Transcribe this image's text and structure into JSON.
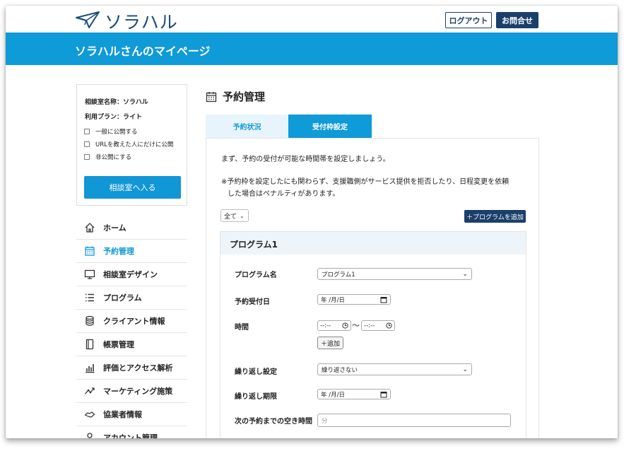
{
  "header": {
    "logo_text": "ソラハル",
    "logout_label": "ログアウト",
    "contact_label": "お問合せ"
  },
  "banner": {
    "title": "ソラハルさんのマイページ"
  },
  "sidebar": {
    "room_name": "相談室名称：ソラハル",
    "plan": "利用プラン：ライト",
    "visibility_options": [
      "一般に公開する",
      "URLを教えた人にだけに公開",
      "非公開にする"
    ],
    "enter_button": "相談室へ入る",
    "nav": [
      {
        "label": "ホーム",
        "icon": "home-icon"
      },
      {
        "label": "予約管理",
        "icon": "calendar-icon",
        "active": true
      },
      {
        "label": "相談室デザイン",
        "icon": "monitor-icon"
      },
      {
        "label": "プログラム",
        "icon": "list-icon"
      },
      {
        "label": "クライアント情報",
        "icon": "database-icon"
      },
      {
        "label": "帳票管理",
        "icon": "document-icon"
      },
      {
        "label": "評価とアクセス解析",
        "icon": "bar-chart-icon"
      },
      {
        "label": "マーケティング施策",
        "icon": "trend-icon"
      },
      {
        "label": "協業者情報",
        "icon": "handshake-icon"
      },
      {
        "label": "アカウント管理",
        "icon": "user-icon"
      }
    ]
  },
  "main": {
    "title": "予約管理",
    "tabs": [
      "予約状況",
      "受付枠設定"
    ],
    "active_tab": "受付枠設定",
    "intro": "まず、予約の受付が可能な時間帯を設定しましょう。",
    "note_line1": "※予約枠を設定したにも関わらず、支援職側がサービス提供を拒否したり、日程変更を依頼",
    "note_line2": "した場合はペナルティがあります。",
    "filter_value": "全て",
    "add_program_button": "＋プログラムを追加",
    "program": {
      "title": "プログラム1",
      "fields": {
        "name_label": "プログラム名",
        "name_value": "プログラム1",
        "date_label": "予約受付日",
        "date_placeholder": "年 /月/日",
        "time_label": "時間",
        "time_placeholder": "--:--",
        "tilde": "〜",
        "add_time_button": "＋追加",
        "repeat_label": "繰り返し設定",
        "repeat_value": "繰り返さない",
        "repeat_until_label": "繰り返し期限",
        "repeat_until_placeholder": "年 /月/日",
        "gap_label": "次の予約までの空き時間",
        "gap_placeholder": "分"
      }
    }
  },
  "colors": {
    "accent": "#0f9ad8",
    "navy": "#1b3f6b"
  }
}
